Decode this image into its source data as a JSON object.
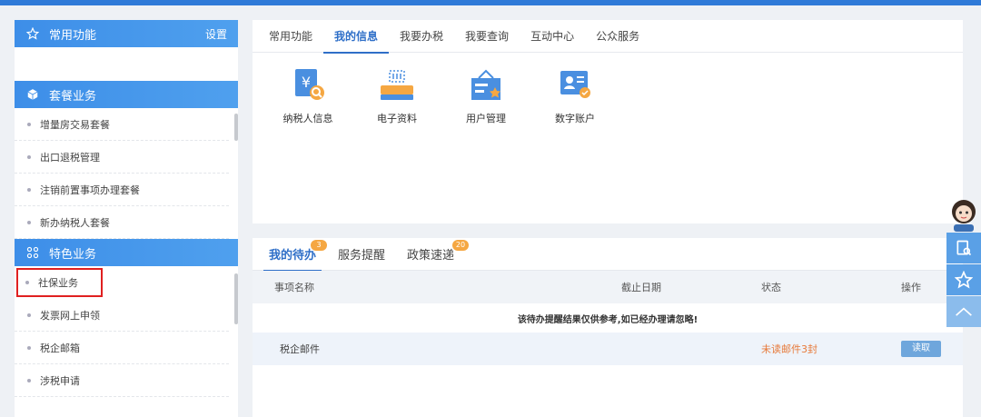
{
  "favorites": {
    "title": "常用功能",
    "setting_label": "设置"
  },
  "packages": {
    "title": "套餐业务",
    "items": [
      "增量房交易套餐",
      "出口退税管理",
      "注销前置事项办理套餐",
      "新办纳税人套餐"
    ]
  },
  "special": {
    "title": "特色业务",
    "items": [
      "社保业务",
      "发票网上申领",
      "税企邮箱",
      "涉税申请"
    ]
  },
  "top_tabs": [
    "常用功能",
    "我的信息",
    "我要办税",
    "我要查询",
    "互动中心",
    "公众服务"
  ],
  "tiles": [
    "纳税人信息",
    "电子资料",
    "用户管理",
    "数字账户"
  ],
  "bottom_tabs": [
    {
      "label": "我的待办",
      "badge": "3"
    },
    {
      "label": "服务提醒",
      "badge": ""
    },
    {
      "label": "政策速递",
      "badge": "20"
    }
  ],
  "table": {
    "headers": [
      "事项名称",
      "截止日期",
      "状态",
      "操作"
    ],
    "notice": "该待办提醒结果仅供参考,如已经办理请忽略!",
    "rows": [
      {
        "name": "税企邮件",
        "date": "",
        "status": "未读邮件3封",
        "action": "读取"
      }
    ]
  },
  "colors": {
    "accent": "#2f6fc8",
    "header_blue": "#3d8ee8",
    "status_orange": "#e77a3a",
    "highlight_red": "#e02020"
  }
}
